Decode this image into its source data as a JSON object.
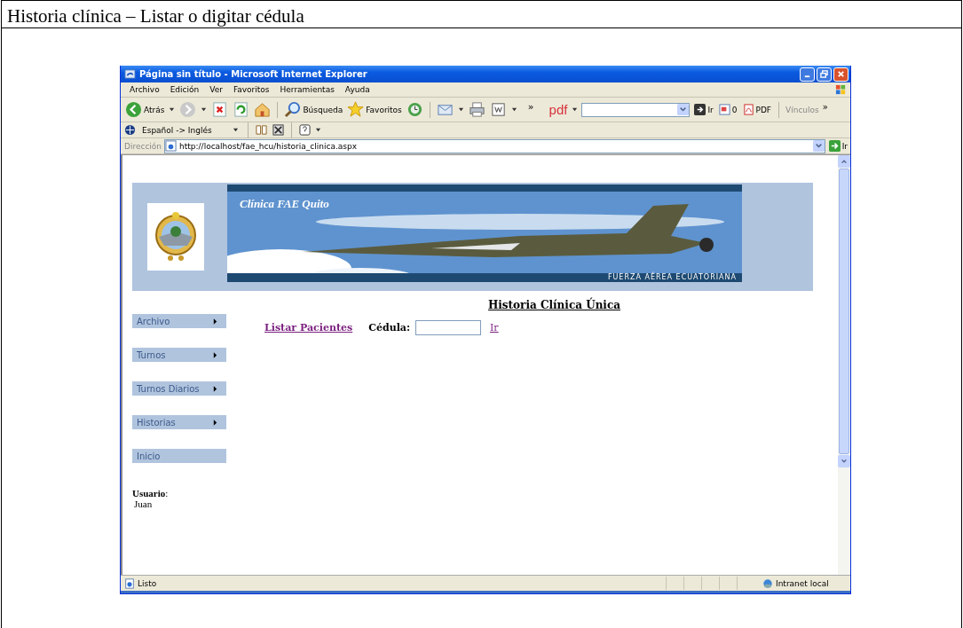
{
  "document": {
    "caption": "Historia clínica – Listar o digitar cédula"
  },
  "window": {
    "title": "Página sin título - Microsoft Internet Explorer"
  },
  "menu_bar": [
    "Archivo",
    "Edición",
    "Ver",
    "Favoritos",
    "Herramientas",
    "Ayuda"
  ],
  "toolbar": [
    {
      "kind": "back",
      "label": "Atrás",
      "dropdown": true
    },
    {
      "kind": "forward",
      "dropdown": true
    },
    {
      "kind": "stop"
    },
    {
      "kind": "refresh"
    },
    {
      "kind": "home"
    },
    {
      "kind": "search",
      "label": "Búsqueda"
    },
    {
      "kind": "favorites",
      "label": "Favoritos"
    },
    {
      "kind": "history"
    },
    {
      "kind": "mail",
      "dropdown": true
    },
    {
      "kind": "print"
    },
    {
      "kind": "word",
      "dropdown": true
    },
    {
      "kind": "more",
      "label": "»"
    }
  ],
  "pdf_toolbar": {
    "label": "pdf",
    "go": "Ir",
    "count": "0",
    "pdf": "PDF",
    "links": "Vínculos",
    "more": "»"
  },
  "translate_bar": {
    "language": "Español -> Inglés"
  },
  "address_bar": {
    "label": "Dirección",
    "url": "http://localhost/fae_hcu/historia_clinica.aspx",
    "go": "Ir"
  },
  "page": {
    "banner": {
      "title": "Clínica FAE Quito",
      "subtitle": "FUERZA AÉREA ECUATORIANA"
    },
    "heading": "Historia Clínica Única",
    "sidebar": [
      {
        "label": "Archivo",
        "submenu": true
      },
      {
        "label": "Turnos",
        "submenu": true
      },
      {
        "label": "Turnos Diarios",
        "submenu": true
      },
      {
        "label": "Historias",
        "submenu": true
      },
      {
        "label": "Inicio",
        "submenu": false
      }
    ],
    "user": {
      "label": "Usuario",
      "separator": ":",
      "name": "Juan"
    },
    "list_link": "Listar Pacientes",
    "id_field": {
      "label": "Cédula:"
    },
    "go_link": "Ir"
  },
  "status_bar": {
    "text": "Listo",
    "zone": "Intranet local"
  }
}
